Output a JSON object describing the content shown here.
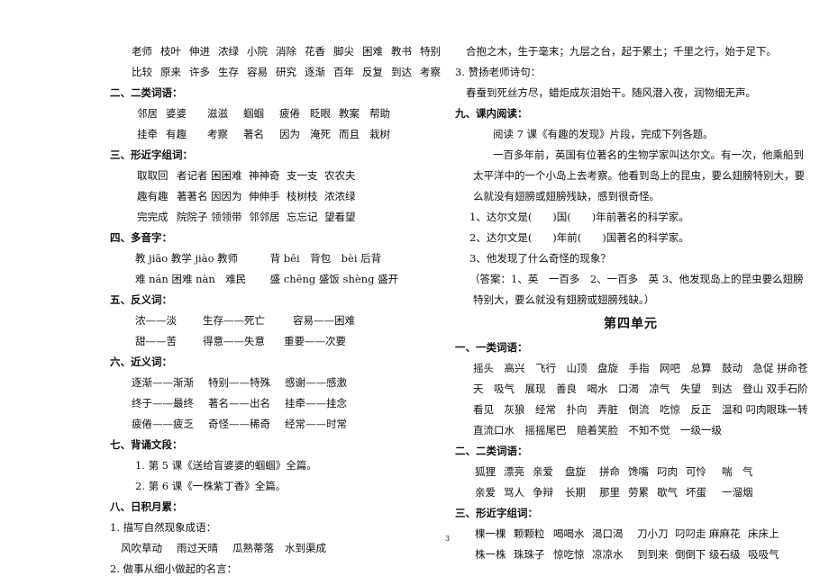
{
  "page_number": "3",
  "left": {
    "s1_rows": [
      [
        "老师",
        "枝叶",
        "伸进",
        "浓绿",
        "小院",
        "消除",
        "花香",
        "脚尖",
        "困难",
        "教书",
        "特别"
      ],
      [
        "比较",
        "原来",
        "许多",
        "生存",
        "容易",
        "研究",
        "逐渐",
        "百年",
        "反复",
        "到达",
        "考察"
      ]
    ],
    "s2_title": "二、二类词语：",
    "s2_rows": [
      [
        "邻居",
        "婆婆",
        "滋滋",
        "蝈蝈",
        "疲倦",
        "眨眼",
        "教案",
        "帮助"
      ],
      [
        "挂牵",
        "有趣",
        "考察",
        "著名",
        "因为",
        "淹死",
        "而且",
        "栽树"
      ]
    ],
    "s3_title": "三、形近字组词：",
    "s3_rows": [
      [
        "取取回",
        "者记者",
        "困困难",
        "神神奇",
        "支一支",
        "农农夫"
      ],
      [
        "趣有趣",
        "著著名",
        "因因为",
        "伸伸手",
        "枝树枝",
        "浓浓绿"
      ],
      [
        "完完成",
        "院院子",
        "领领带",
        "邻邻居",
        "忘忘记",
        "望看望"
      ]
    ],
    "s4_title": "四、多音字：",
    "s4_rows": [
      {
        "a": "教 jiāo 教学 jiào 教师",
        "b": "背 bēi　背包　bèi 后背"
      },
      {
        "a": "难 nán 困难 nàn　难民",
        "b": "盛 chēng 盛饭 shèng 盛开"
      }
    ],
    "s5_title": "五、反义词：",
    "s5_rows": [
      [
        "浓——淡",
        "生存——死亡",
        "容易——困难"
      ],
      [
        "甜——苦",
        "得意——失意",
        "重要——次要"
      ]
    ],
    "s6_title": "六、近义词：",
    "s6_rows": [
      [
        "逐渐——渐渐",
        "特别——特殊",
        "感谢——感激"
      ],
      [
        "终于——最终",
        "著名——出名",
        "挂牵——挂念"
      ],
      [
        "疲倦——疲乏",
        "奇怪——稀奇",
        "经常——时常"
      ]
    ],
    "s7_title": "七、背诵文段：",
    "s7_items": [
      "1. 第 5 课《送给盲婆婆的蝈蝈》全篇。",
      "2. 第 6 课《一株紫丁香》全篇。"
    ],
    "s8_title": "八、日积月累：",
    "s8_sub1": "1. 描写自然现象成语：",
    "s8_idioms": [
      "风吹草动",
      "雨过天晴",
      "瓜熟蒂落",
      "水到渠成"
    ],
    "s8_sub2": "2. 做事从细小做起的名言："
  },
  "right": {
    "quote": "合抱之木，生于毫末；九层之台，起于累土；千里之行，始于足下。",
    "sub3": "3. 赞扬老师诗句：",
    "poem": "春蚕到死丝方尽，蜡炬成灰泪始干。随风潜入夜，润物细无声。",
    "s9_title": "九、课内阅读：",
    "s9_intro": "阅读 7 课《有趣的发现》片段，完成下列各题。",
    "s9_passage": [
      "一百多年前，英国有位著名的生物学家叫达尔文。有一次，他乘船到",
      "太平洋中的一个小岛上去考察。他看到岛上的昆虫，要么翅膀特别大，要",
      "么就没有翅膀或翅膀残缺，感到很奇怪。"
    ],
    "s9_q1": "1、达尔文是(　　)国(　　)年前著名的科学家。",
    "s9_q2": "2、达尔文是(　　)年前(　　)国著名的科学家。",
    "s9_q3": "3、他发现了什么奇怪的现象？",
    "s9_answer": [
      "（答案：1、英　一百多　2、一百多　英 3、他发现岛上的昆虫要么翅膀",
      "特别大，要么就没有翅膀或翅膀残缺。）"
    ],
    "unit_title": "第四单元",
    "u4_s1_title": "一、一类词语：",
    "u4_s1_rows": [
      "摇头　高兴　飞行　山顶　盘旋　手指　网吧　总算　鼓动　急促 拼命苍",
      "天　吸气　展现　善良　喝水　口渴　凉气　失望　到达　登山 双手石阶",
      "看见　灰狼　经常　扑向　弄脏　倒流　吃惊　反正　温和 叼肉眼珠一转",
      "直流口水　摇摇尾巴　赔着笑脸　不知不觉　一级一级"
    ],
    "u4_s2_title": "二、二类词语：",
    "u4_s2_rows": [
      [
        "狐狸",
        "漂亮",
        "亲爱",
        "盘旋",
        "拼命",
        "馋嘴",
        "叼肉",
        "可怜",
        "喘　气"
      ],
      [
        "亲爱",
        "骂人",
        "争辩",
        "长期",
        "那里",
        "劳累",
        "歇气",
        "坏蛋",
        "一溜烟"
      ]
    ],
    "u4_s3_title": "三、形近字组词：",
    "u4_s3_rows": [
      [
        "棵一棵",
        "颗颗粒",
        "喝喝水",
        "渴口渴",
        "刀小刀",
        "叼叼走",
        "麻麻花",
        "床床上"
      ],
      [
        "株一株",
        "珠珠子",
        "惊吃惊",
        "凉凉水",
        "到到来",
        "倒倒下",
        "级石级",
        "吸吸气"
      ]
    ]
  }
}
